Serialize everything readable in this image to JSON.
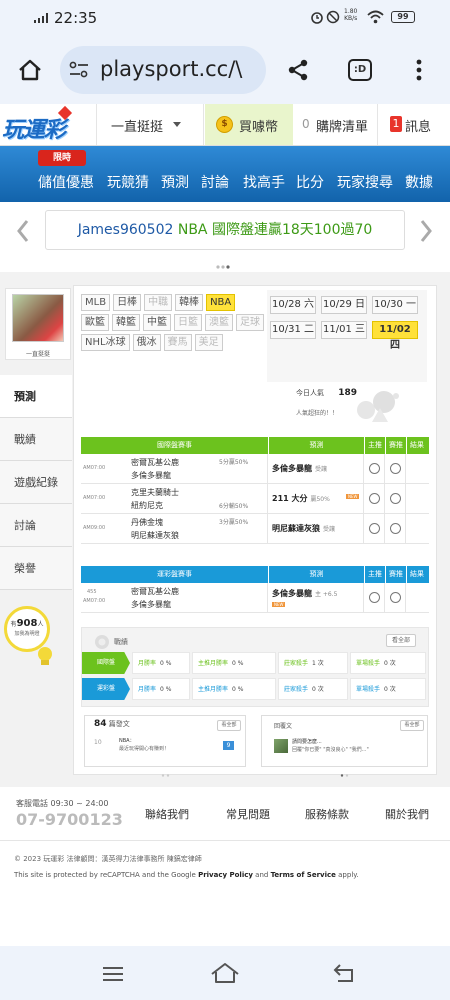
{
  "status": {
    "time": "22:35",
    "speed": "1.80\nKB/s",
    "battery": "99"
  },
  "browser": {
    "url": "playsport.cc/\\"
  },
  "site": {
    "logo": "玩運彩",
    "menu": "一直挺挺",
    "coin": "買噱幣",
    "cart_count": "0",
    "cart": "購牌清單",
    "msg_count": "1",
    "msg": "訊息"
  },
  "nav": {
    "promo": "限時",
    "items": [
      "儲值優惠",
      "玩競猜",
      "預測",
      "討論",
      "找高手",
      "比分",
      "玩家搜尋",
      "數據"
    ]
  },
  "marquee": {
    "user": "James960502",
    "text": "NBA 國際盤連贏18天100過70"
  },
  "profile": {
    "name": "一直挺挺"
  },
  "sports": [
    {
      "label": "MLB",
      "state": ""
    },
    {
      "label": "日棒",
      "state": ""
    },
    {
      "label": "中職",
      "state": "off"
    },
    {
      "label": "韓棒",
      "state": ""
    },
    {
      "label": "NBA",
      "state": "on"
    },
    {
      "label": "歐籃",
      "state": ""
    },
    {
      "label": "韓籃",
      "state": ""
    },
    {
      "label": "中籃",
      "state": ""
    },
    {
      "label": "日籃",
      "state": "off"
    },
    {
      "label": "澳籃",
      "state": "off"
    },
    {
      "label": "足球",
      "state": "off"
    },
    {
      "label": "NHL冰球",
      "state": ""
    },
    {
      "label": "俄冰",
      "state": ""
    },
    {
      "label": "賽馬",
      "state": "off"
    },
    {
      "label": "美足",
      "state": "off"
    }
  ],
  "dates": [
    {
      "label": "10/28 六",
      "state": ""
    },
    {
      "label": "10/29 日",
      "state": ""
    },
    {
      "label": "10/30 一",
      "state": ""
    },
    {
      "label": "10/31 二",
      "state": ""
    },
    {
      "label": "11/01 三",
      "state": ""
    },
    {
      "label": "11/02 四",
      "state": "on"
    }
  ],
  "sidebar": {
    "items": [
      "預測",
      "戰績",
      "遊戲紀錄",
      "討論",
      "榮譽"
    ],
    "visitors_prefix": "有",
    "visitors": "908",
    "visitors_unit": "人",
    "visitors_note": "加我為明燈"
  },
  "stats": {
    "today_label": "今日人氣",
    "today_value": "189",
    "fans_label": "人氣超狂的！！"
  },
  "intl": {
    "header": "國際盤賽事",
    "pred": "預測",
    "main": "主推",
    "bet": "賽推",
    "result": "結果",
    "rows": [
      {
        "time": "AM07:00",
        "home": "密爾瓦基公鹿",
        "away": "多倫多暴龍",
        "odds": "5分贏50%",
        "pick": "多倫多暴龍",
        "pick_note": "受讓",
        "tag": ""
      },
      {
        "time": "AM07:00",
        "home": "克里夫蘭騎士",
        "away": "紐約尼克",
        "odds": "6分輸50%",
        "pick": "211 大分",
        "pick_note": "贏50%",
        "tag": "NEW"
      },
      {
        "time": "AM09:00",
        "home": "丹佛金塊",
        "away": "明尼蘇達灰狼",
        "odds": "3分贏50%",
        "pick": "明尼蘇達灰狼",
        "pick_note": "受讓",
        "tag": ""
      }
    ]
  },
  "tw": {
    "header": "運彩盤賽事",
    "pred": "預測",
    "main": "主推",
    "bet": "賽推",
    "result": "結果",
    "rows": [
      {
        "code": "455",
        "time": "AM07:00",
        "home": "密爾瓦基公鹿",
        "away": "多倫多暴龍",
        "pick": "多倫多暴龍",
        "pick_note": "主 +6.5",
        "tag": "NEW"
      }
    ]
  },
  "record": {
    "title": "戰績",
    "all": "看全部",
    "rows": [
      {
        "label": "國際盤",
        "win_label": "月勝率",
        "win": "0 %",
        "main_label": "主推月勝率",
        "main": "0 %",
        "streak_label": "莊家殺手",
        "streak": "1 次",
        "single_label": "單場殺手",
        "single": "0 次",
        "color": "#6cc21e"
      },
      {
        "label": "運彩盤",
        "win_label": "月勝率",
        "win": "0 %",
        "main_label": "主推月勝率",
        "main": "0 %",
        "streak_label": "莊家殺手",
        "streak": "0 次",
        "single_label": "單場殺手",
        "single": "0 次",
        "color": "#1a9ad8"
      }
    ]
  },
  "posts": {
    "count": "84",
    "title": "篇發文",
    "all": "看全部",
    "item_num": "10",
    "item_tag": "NBA：",
    "item_text": "最近玩得開心有賺到！",
    "item_count": "9"
  },
  "replies": {
    "title": "回覆文",
    "all": "看全部",
    "item_title": "請問要怎麼...",
    "item_text": "回覆\"你已要\" \"真沒良心\" \"我們...\""
  },
  "footer": {
    "service_label": "客服電話 09:30 ~ 24:00",
    "phone": "07-9700123",
    "links": [
      "聯絡我們",
      "常見問題",
      "服務條款",
      "關於我們"
    ],
    "copyright": "© 2023 玩運彩 法律顧問：漢英得力法律事務所 陳鎬宏律師",
    "recaptcha_a": "This site is protected by reCAPTCHA and the Google ",
    "privacy": "Privacy Policy",
    "and": " and ",
    "terms": "Terms of Service",
    "apply": " apply."
  }
}
